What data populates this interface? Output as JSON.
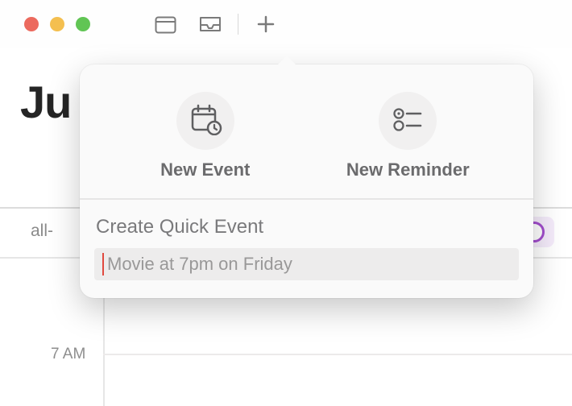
{
  "toolbar": {
    "icons": {
      "calendars": "calendars-icon",
      "inbox": "inbox-icon",
      "add": "plus-icon"
    }
  },
  "main": {
    "title_fragment": "Ju",
    "allday_label": "all-",
    "ellipsis": "...",
    "hours": {
      "7am": "7 AM"
    }
  },
  "popover": {
    "new_event_label": "New Event",
    "new_reminder_label": "New Reminder",
    "quick_heading": "Create Quick Event",
    "quick_placeholder": "Movie at 7pm on Friday"
  }
}
